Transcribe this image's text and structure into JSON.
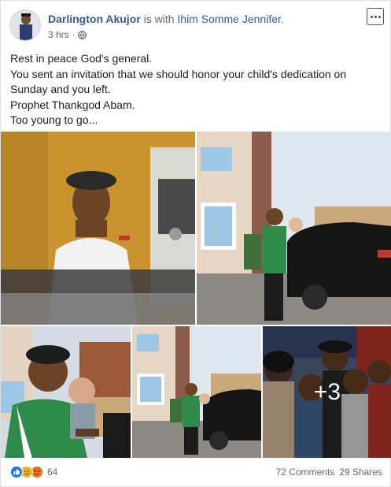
{
  "header": {
    "author": "Darlington Akujor",
    "connector": " is with ",
    "tagged": "Ihim Somme Jennifer",
    "period": ".",
    "time": "3 hrs",
    "separator": "·",
    "privacy_icon": "globe-icon",
    "more_icon": "more-options-icon"
  },
  "post": {
    "lines": [
      "Rest in peace God's general.",
      "You sent an invitation that we should honor your child's dedication on Sunday and you left.",
      "Prophet Thankgod Abam.",
      "Too young to go..."
    ]
  },
  "photos": {
    "extra_count": "+3"
  },
  "footer": {
    "reaction_icons": [
      "like-icon",
      "sad-icon",
      "angry-icon"
    ],
    "reaction_count": "64",
    "comments": "72 Comments",
    "shares": "29 Shares"
  },
  "colors": {
    "link": "#385898",
    "meta": "#606770",
    "like": "#1877f2",
    "sad": "#f7b125",
    "angry": "#e9710f"
  }
}
